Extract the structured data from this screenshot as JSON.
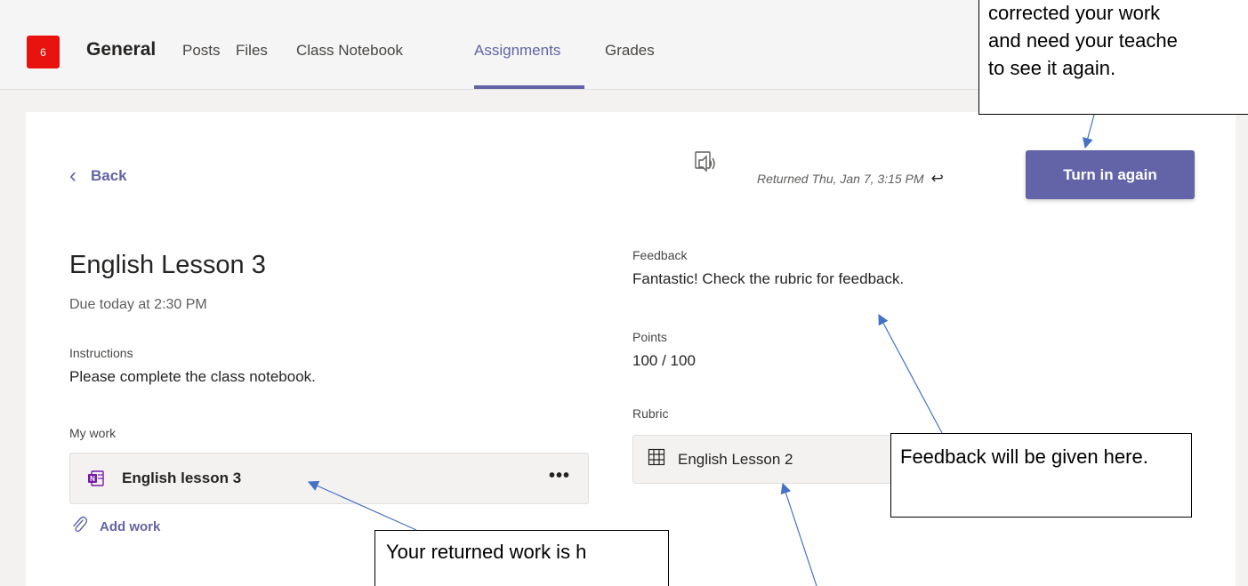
{
  "header": {
    "team_badge": "6",
    "channel_name": "General",
    "tabs": [
      {
        "label": "Posts"
      },
      {
        "label": "Files"
      },
      {
        "label": "Class Notebook"
      },
      {
        "label": "Assignments"
      },
      {
        "label": "Grades"
      }
    ],
    "active_tab": "Assignments"
  },
  "toolbar": {
    "back_label": "Back",
    "returned_text": "Returned Thu, Jan 7, 3:15 PM",
    "turn_in_label": "Turn in again"
  },
  "assignment": {
    "title": "English Lesson 3",
    "due": "Due today at 2:30 PM",
    "instructions_label": "Instructions",
    "instructions_text": "Please complete the class notebook.",
    "my_work_label": "My work",
    "work_item": "English lesson 3",
    "more_label": "•••",
    "add_work_label": "Add work"
  },
  "feedback": {
    "feedback_label": "Feedback",
    "feedback_text": "Fantastic! Check the rubric for feedback.",
    "points_label": "Points",
    "points_value": "100 / 100",
    "rubric_label": "Rubric",
    "rubric_item": "English Lesson 2"
  },
  "callouts": {
    "top_lines": [
      "corrected your work",
      "and need your teache",
      "to see it again."
    ],
    "feedback_text": "Feedback will be given here.",
    "work_text": "Your returned work is h"
  },
  "colors": {
    "accent": "#6264a7",
    "badge": "#e8130f"
  }
}
